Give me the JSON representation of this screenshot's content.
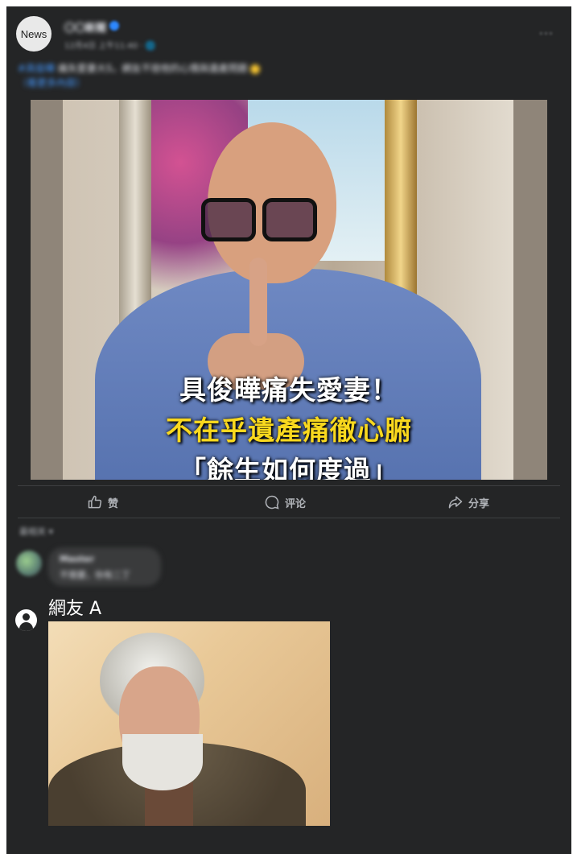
{
  "post": {
    "avatar_label": "News",
    "page_name": "〇〇新聞",
    "meta": "12月4日 上午11:40 · 🌐",
    "more_label": "···",
    "caption_tag": "#具俊曄",
    "caption_text": "痛失愛妻大S，網友不捨他的心情與遺產問題",
    "caption_link": "（看更多內容）",
    "photo_lines": [
      "具俊曄痛失愛妻！",
      "不在乎遺產痛徹心腑",
      "「餘生如何度過」"
    ]
  },
  "actions": {
    "like": "赞",
    "comment": "评论",
    "share": "分享"
  },
  "comments": {
    "sort_label": "最相关 ▾",
    "first": {
      "name": "Master",
      "text": "不需要，你有二丁"
    }
  },
  "reply": {
    "name": "網友 A"
  },
  "colors": {
    "card_bg": "#242526",
    "text": "#e4e6eb",
    "muted": "#b0b3b8",
    "highlight_yellow": "#f9d81e",
    "link_blue": "#4599ff"
  },
  "icons": [
    "thumbs-up-icon",
    "comment-bubble-icon",
    "share-arrow-icon",
    "user-avatar-icon",
    "verified-badge-icon",
    "more-dots-icon"
  ]
}
